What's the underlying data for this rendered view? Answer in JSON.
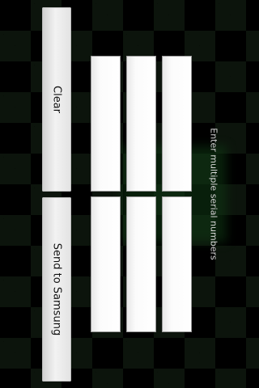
{
  "screen": {
    "title": "Enter multiple serial numbers"
  },
  "buttons": {
    "clear": "Clear",
    "send": "Send to Samsung"
  },
  "serial_fields": [
    {
      "value": ""
    },
    {
      "value": ""
    },
    {
      "value": ""
    },
    {
      "value": ""
    },
    {
      "value": ""
    },
    {
      "value": ""
    }
  ],
  "colors": {
    "background": "#000000",
    "checker": "#0c140c",
    "field": "#ffffff",
    "button": "#ececec",
    "title_text": "#d6d6d6"
  }
}
